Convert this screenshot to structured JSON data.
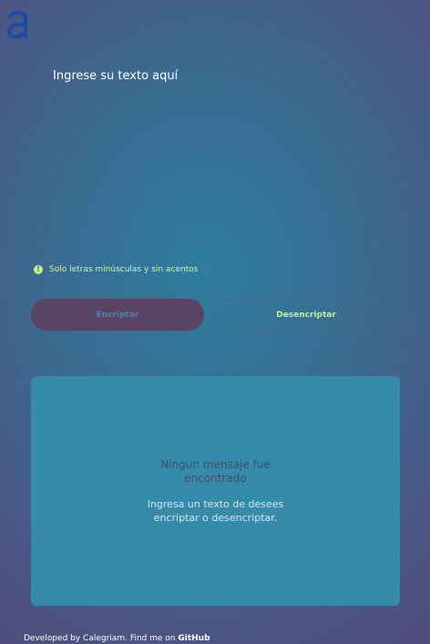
{
  "logo": {
    "icon": "logo-a-icon",
    "color": "#1d4ba3"
  },
  "input": {
    "placeholder": "Ingrese su texto aquí"
  },
  "hint": {
    "icon": "info-icon",
    "icon_glyph": "!",
    "text": "Solo letras minúsculas y sin acentos"
  },
  "buttons": {
    "encrypt_label": "Encriptar",
    "decrypt_label": "Desencriptar"
  },
  "output": {
    "title": "Ningun mensaje fue encontrado",
    "subtitle": "Ingresa un texto de desees encriptar o desencriptar."
  },
  "footer": {
    "text": "Developed by Calegriam. Find me on ",
    "link_label": "GitHub"
  },
  "colors": {
    "accent": "#c9f07a",
    "panel": "#358ba9",
    "encrypt_button": "#5a4466"
  }
}
